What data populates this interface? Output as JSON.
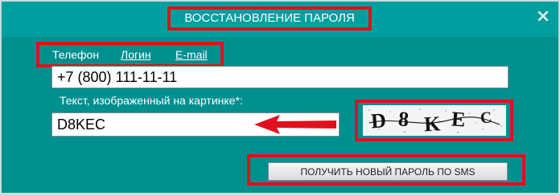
{
  "dialog": {
    "title": "ВОССТАНОВЛЕНИЕ ПАРОЛЯ",
    "close_glyph": "✕"
  },
  "tabs": [
    {
      "label": "Телефон"
    },
    {
      "label": "Логин"
    },
    {
      "label": "E-mail"
    }
  ],
  "phone_field": {
    "value": "+7 (800) 111-11-11"
  },
  "captcha": {
    "label": "Текст, изображенный на картинке*:",
    "input_value": "D8KEC",
    "image_text": "D8KEC"
  },
  "sms_button_label": "ПОЛУЧИТЬ НОВЫЙ ПАРОЛЬ ПО SMS",
  "colors": {
    "background": "#008f8f",
    "titlebar": "#009f9f",
    "highlight_frame": "#e0101c",
    "arrow": "#e0101c"
  },
  "icons": [
    "close-icon",
    "arrow-icon"
  ]
}
